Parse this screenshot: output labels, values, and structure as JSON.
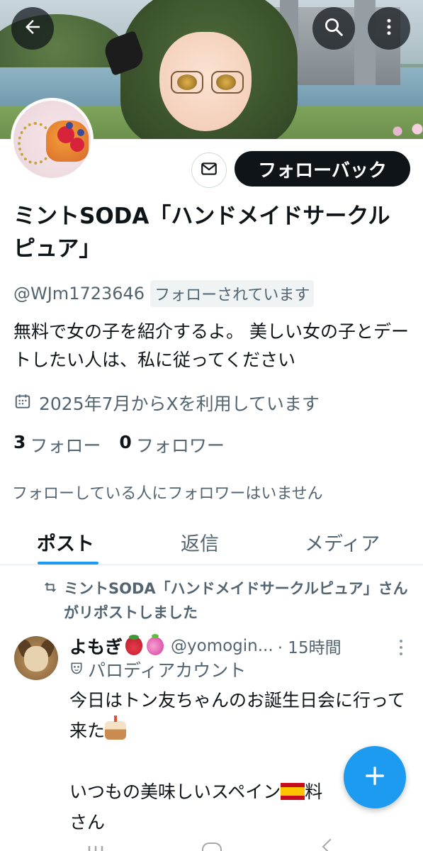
{
  "header": {
    "back_icon": "arrow-left-icon",
    "search_icon": "search-icon",
    "more_icon": "more-vertical-icon"
  },
  "profile": {
    "display_name": "ミントSODA「ハンドメイドサークルピュア」",
    "handle": "@WJm1723646",
    "follows_you": "フォローされています",
    "bio": "無料で女の子を紹介するよ。 美しい女の子とデートしたい人は、私に従ってください",
    "joined": "2025年7月からXを利用しています",
    "following_count": "3",
    "following_label": "フォロー",
    "followers_count": "0",
    "followers_label": "フォロワー",
    "no_mutual_followers": "フォローしている人にフォロワーはいません",
    "follow_back_label": "フォローバック",
    "message_icon": "mail-icon"
  },
  "tabs": [
    {
      "label": "ポスト",
      "active": true
    },
    {
      "label": "返信",
      "active": false
    },
    {
      "label": "メディア",
      "active": false
    }
  ],
  "post": {
    "repost_text": "ミントSODA「ハンドメイドサークルピュア」さんがリポストしました",
    "author_name": "よもぎ",
    "author_handle": "@yomogin...",
    "time": "· 15時間",
    "parody_label": "パロディアカウント",
    "body_line1": "今日はトン友ちゃんのお誕生日会に行って来た",
    "body_line2a": "いつもの美味しいスペイン",
    "body_line2b": "料",
    "body_line3": "さん"
  },
  "fab_icon": "plus-icon",
  "colors": {
    "accent": "#1d9bf0",
    "text_primary": "#0f1419",
    "text_secondary": "#536471",
    "button_dark": "#0f1419"
  }
}
